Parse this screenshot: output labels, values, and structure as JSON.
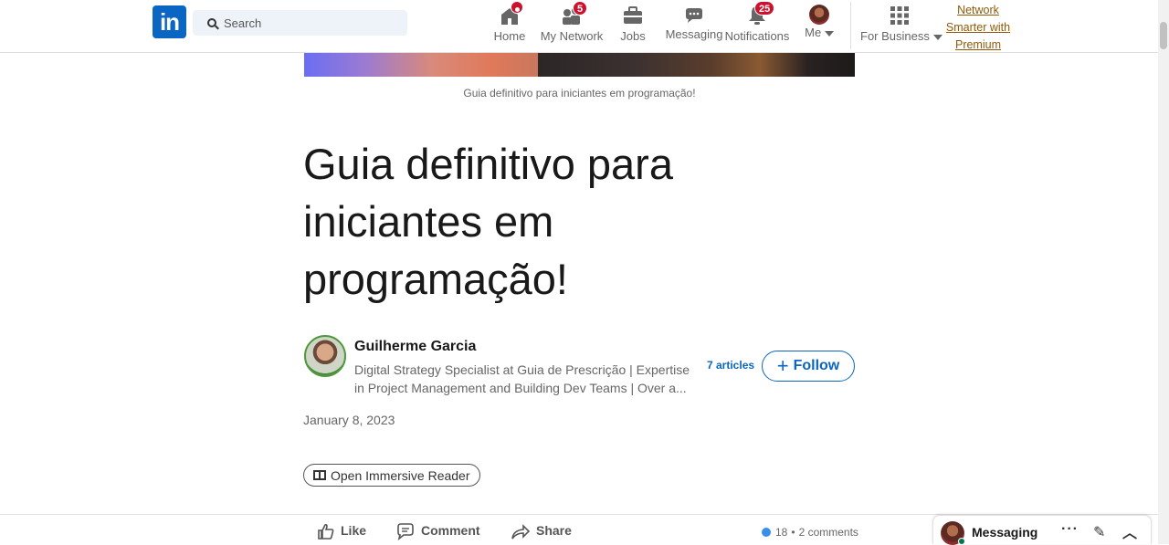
{
  "nav": {
    "logo_text": "in",
    "search_placeholder": "Search",
    "home_label": "Home",
    "network_label": "My Network",
    "network_badge": "5",
    "jobs_label": "Jobs",
    "messaging_label": "Messaging",
    "notifications_label": "Notifications",
    "notifications_badge": "25",
    "me_label": "Me",
    "business_label": "For Business",
    "premium_line1": "Network",
    "premium_line2": "Smarter with",
    "premium_line3": "Premium"
  },
  "article": {
    "cover_caption": "Guia definitivo para iniciantes em programação!",
    "title": "Guia definitivo para iniciantes em programação!",
    "author_name": "Guilherme Garcia",
    "author_headline": "Digital Strategy Specialist at Guia de Prescrição | Expertise in Project Management and Building Dev Teams | Over a...",
    "articles_count": "7 articles",
    "follow_label": "Follow",
    "date": "January 8, 2023",
    "immersive_label": "Open Immersive Reader"
  },
  "actions": {
    "like_label": "Like",
    "comment_label": "Comment",
    "share_label": "Share",
    "reactions_count": "18",
    "separator": "•",
    "comments_count": "2 comments"
  },
  "messaging_bar": {
    "title": "Messaging",
    "more_icon": "···",
    "compose_icon": "✎",
    "collapse_icon": "︿"
  },
  "colors": {
    "brand": "#0a66c2",
    "badge": "#cb112d",
    "premium": "#915907"
  }
}
